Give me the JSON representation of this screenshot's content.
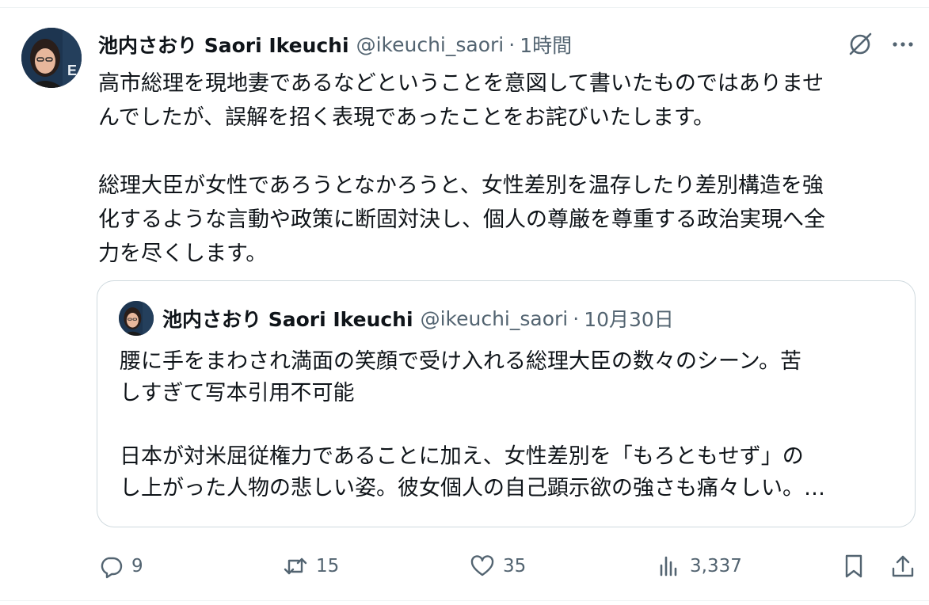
{
  "tweet": {
    "display_name": "池内さおり Saori Ikeuchi",
    "handle": "@ikeuchi_saori",
    "separator": "·",
    "time": "1時間",
    "body": [
      "高市総理を現地妻であるなどということを意図して書いたものではありませ",
      "んでしたが、誤解を招く表現であったことをお詫びいたします。",
      "",
      "総理大臣が女性であろうとなかろうと、女性差別を温存したり差別構造を強",
      "化するような言動や政策に断固対決し、個人の尊厳を尊重する政治実現へ全",
      "力を尽くします。"
    ]
  },
  "quote": {
    "display_name": "池内さおり Saori Ikeuchi",
    "handle": "@ikeuchi_saori",
    "separator": "·",
    "time": "10月30日",
    "body": [
      "腰に手をまわされ満面の笑顔で受け入れる総理大臣の数々のシーン。苦",
      "しすぎて写本引用不可能",
      "",
      "日本が対米屈従権力であることに加え、女性差別を「もろともせず」の",
      "し上がった人物の悲しい姿。彼女個人の自己顕示欲の強さも痛々しい。…"
    ]
  },
  "actions": {
    "replies": "9",
    "retweets": "15",
    "likes": "35",
    "views": "3,337"
  },
  "icons": {
    "reply": "reply-icon",
    "retweet": "retweet-icon",
    "like": "heart-icon",
    "views": "views-icon",
    "bookmark": "bookmark-icon",
    "share": "share-icon",
    "grok": "grok-icon",
    "more": "more-icon"
  },
  "colors": {
    "text": "#0f1419",
    "secondary": "#536471",
    "border": "#cfd9de"
  }
}
